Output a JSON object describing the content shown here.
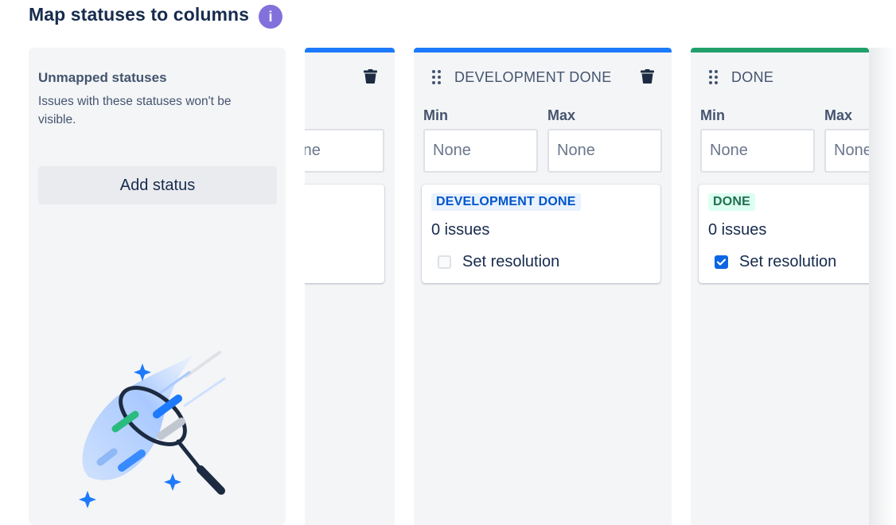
{
  "page": {
    "title": "Map statuses to columns",
    "info_symbol": "i"
  },
  "unmapped": {
    "title": "Unmapped statuses",
    "description": "Issues with these statuses won't be visible.",
    "add_status_label": "Add status"
  },
  "labels": {
    "min": "Min",
    "max": "Max"
  },
  "columns": [
    {
      "name": "",
      "accent": "#1d7afc",
      "max_placeholder": "None",
      "partially_visible": true
    },
    {
      "name": "DEVELOPMENT DONE",
      "accent": "#1d7afc",
      "min_placeholder": "None",
      "max_placeholder": "None",
      "status": {
        "lozenge": "DEVELOPMENT DONE",
        "lozenge_bg": "#e9f2ff",
        "lozenge_fg": "#0055cc",
        "issues": "0 issues",
        "resolution_label": "Set resolution",
        "resolution_checked": false
      }
    },
    {
      "name": "DONE",
      "accent": "#22a06b",
      "min_placeholder": "None",
      "max_placeholder": "None",
      "status": {
        "lozenge": "DONE",
        "lozenge_bg": "#dcfff1",
        "lozenge_fg": "#216e4e",
        "issues": "0 issues",
        "resolution_label": "Set resolution",
        "resolution_checked": true
      }
    }
  ],
  "icons": {
    "info": "info-icon",
    "drag": "drag-handle-icon",
    "delete": "trash-icon",
    "check": "checkmark-icon",
    "illustration": "badminton-racket-illustration"
  }
}
